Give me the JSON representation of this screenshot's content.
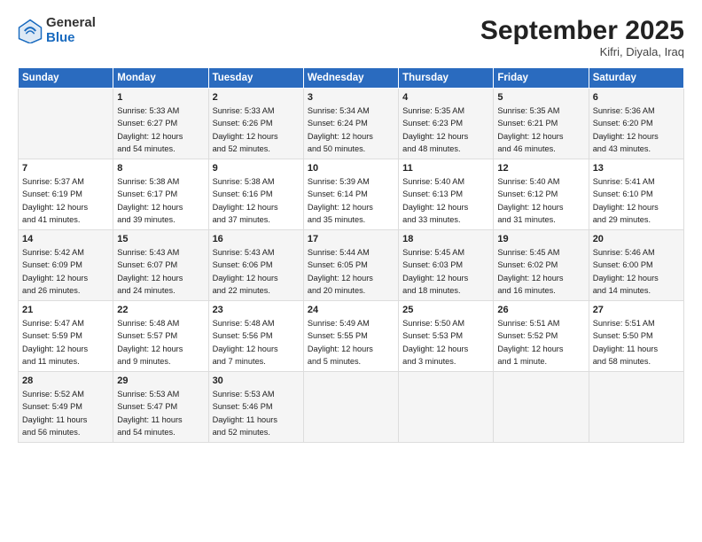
{
  "header": {
    "logo_general": "General",
    "logo_blue": "Blue",
    "month_title": "September 2025",
    "location": "Kifri, Diyala, Iraq"
  },
  "weekdays": [
    "Sunday",
    "Monday",
    "Tuesday",
    "Wednesday",
    "Thursday",
    "Friday",
    "Saturday"
  ],
  "weeks": [
    [
      {
        "day": "",
        "info": ""
      },
      {
        "day": "1",
        "info": "Sunrise: 5:33 AM\nSunset: 6:27 PM\nDaylight: 12 hours\nand 54 minutes."
      },
      {
        "day": "2",
        "info": "Sunrise: 5:33 AM\nSunset: 6:26 PM\nDaylight: 12 hours\nand 52 minutes."
      },
      {
        "day": "3",
        "info": "Sunrise: 5:34 AM\nSunset: 6:24 PM\nDaylight: 12 hours\nand 50 minutes."
      },
      {
        "day": "4",
        "info": "Sunrise: 5:35 AM\nSunset: 6:23 PM\nDaylight: 12 hours\nand 48 minutes."
      },
      {
        "day": "5",
        "info": "Sunrise: 5:35 AM\nSunset: 6:21 PM\nDaylight: 12 hours\nand 46 minutes."
      },
      {
        "day": "6",
        "info": "Sunrise: 5:36 AM\nSunset: 6:20 PM\nDaylight: 12 hours\nand 43 minutes."
      }
    ],
    [
      {
        "day": "7",
        "info": "Sunrise: 5:37 AM\nSunset: 6:19 PM\nDaylight: 12 hours\nand 41 minutes."
      },
      {
        "day": "8",
        "info": "Sunrise: 5:38 AM\nSunset: 6:17 PM\nDaylight: 12 hours\nand 39 minutes."
      },
      {
        "day": "9",
        "info": "Sunrise: 5:38 AM\nSunset: 6:16 PM\nDaylight: 12 hours\nand 37 minutes."
      },
      {
        "day": "10",
        "info": "Sunrise: 5:39 AM\nSunset: 6:14 PM\nDaylight: 12 hours\nand 35 minutes."
      },
      {
        "day": "11",
        "info": "Sunrise: 5:40 AM\nSunset: 6:13 PM\nDaylight: 12 hours\nand 33 minutes."
      },
      {
        "day": "12",
        "info": "Sunrise: 5:40 AM\nSunset: 6:12 PM\nDaylight: 12 hours\nand 31 minutes."
      },
      {
        "day": "13",
        "info": "Sunrise: 5:41 AM\nSunset: 6:10 PM\nDaylight: 12 hours\nand 29 minutes."
      }
    ],
    [
      {
        "day": "14",
        "info": "Sunrise: 5:42 AM\nSunset: 6:09 PM\nDaylight: 12 hours\nand 26 minutes."
      },
      {
        "day": "15",
        "info": "Sunrise: 5:43 AM\nSunset: 6:07 PM\nDaylight: 12 hours\nand 24 minutes."
      },
      {
        "day": "16",
        "info": "Sunrise: 5:43 AM\nSunset: 6:06 PM\nDaylight: 12 hours\nand 22 minutes."
      },
      {
        "day": "17",
        "info": "Sunrise: 5:44 AM\nSunset: 6:05 PM\nDaylight: 12 hours\nand 20 minutes."
      },
      {
        "day": "18",
        "info": "Sunrise: 5:45 AM\nSunset: 6:03 PM\nDaylight: 12 hours\nand 18 minutes."
      },
      {
        "day": "19",
        "info": "Sunrise: 5:45 AM\nSunset: 6:02 PM\nDaylight: 12 hours\nand 16 minutes."
      },
      {
        "day": "20",
        "info": "Sunrise: 5:46 AM\nSunset: 6:00 PM\nDaylight: 12 hours\nand 14 minutes."
      }
    ],
    [
      {
        "day": "21",
        "info": "Sunrise: 5:47 AM\nSunset: 5:59 PM\nDaylight: 12 hours\nand 11 minutes."
      },
      {
        "day": "22",
        "info": "Sunrise: 5:48 AM\nSunset: 5:57 PM\nDaylight: 12 hours\nand 9 minutes."
      },
      {
        "day": "23",
        "info": "Sunrise: 5:48 AM\nSunset: 5:56 PM\nDaylight: 12 hours\nand 7 minutes."
      },
      {
        "day": "24",
        "info": "Sunrise: 5:49 AM\nSunset: 5:55 PM\nDaylight: 12 hours\nand 5 minutes."
      },
      {
        "day": "25",
        "info": "Sunrise: 5:50 AM\nSunset: 5:53 PM\nDaylight: 12 hours\nand 3 minutes."
      },
      {
        "day": "26",
        "info": "Sunrise: 5:51 AM\nSunset: 5:52 PM\nDaylight: 12 hours\nand 1 minute."
      },
      {
        "day": "27",
        "info": "Sunrise: 5:51 AM\nSunset: 5:50 PM\nDaylight: 11 hours\nand 58 minutes."
      }
    ],
    [
      {
        "day": "28",
        "info": "Sunrise: 5:52 AM\nSunset: 5:49 PM\nDaylight: 11 hours\nand 56 minutes."
      },
      {
        "day": "29",
        "info": "Sunrise: 5:53 AM\nSunset: 5:47 PM\nDaylight: 11 hours\nand 54 minutes."
      },
      {
        "day": "30",
        "info": "Sunrise: 5:53 AM\nSunset: 5:46 PM\nDaylight: 11 hours\nand 52 minutes."
      },
      {
        "day": "",
        "info": ""
      },
      {
        "day": "",
        "info": ""
      },
      {
        "day": "",
        "info": ""
      },
      {
        "day": "",
        "info": ""
      }
    ]
  ]
}
